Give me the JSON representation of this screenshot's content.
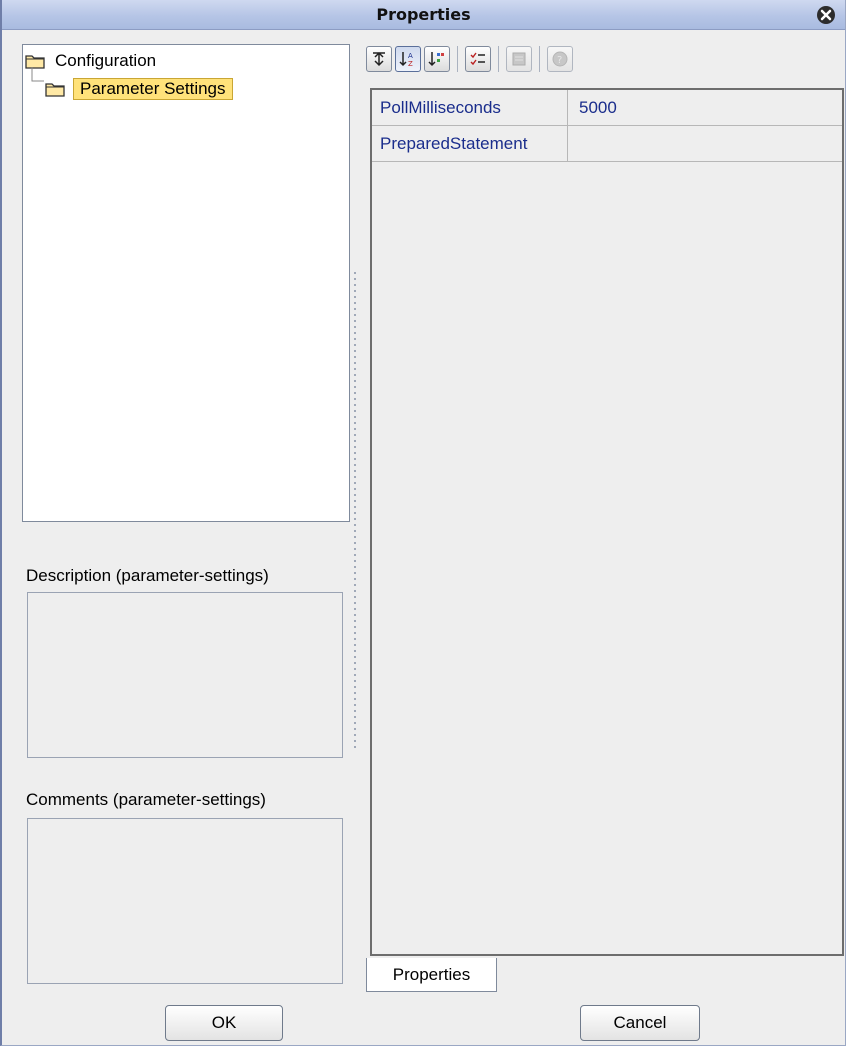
{
  "window": {
    "title": "Properties"
  },
  "tree": {
    "root": {
      "label": "Configuration",
      "icon": "folder-icon"
    },
    "child": {
      "label": "Parameter Settings",
      "icon": "folder-icon",
      "selected": true
    }
  },
  "description": {
    "label": "Description (parameter-settings)",
    "text": ""
  },
  "comments": {
    "label": "Comments (parameter-settings)",
    "text": ""
  },
  "toolbar": {
    "buttons": [
      {
        "icon": "collapse-icon",
        "pressed": false,
        "disabled": false
      },
      {
        "icon": "sort-alphabetical-icon",
        "pressed": true,
        "disabled": false
      },
      {
        "icon": "sort-category-icon",
        "pressed": false,
        "disabled": false
      },
      {
        "icon": "checklist-icon",
        "pressed": false,
        "disabled": false
      },
      {
        "icon": "property-pages-icon",
        "pressed": false,
        "disabled": true
      },
      {
        "icon": "help-icon",
        "pressed": false,
        "disabled": true
      }
    ]
  },
  "properties": {
    "rows": [
      {
        "name": "PollMilliseconds",
        "value": "5000"
      },
      {
        "name": "PreparedStatement",
        "value": ""
      }
    ]
  },
  "tabs": [
    {
      "label": "Properties",
      "active": true
    }
  ],
  "buttons": {
    "ok": "OK",
    "cancel": "Cancel"
  },
  "colors": {
    "title_gradient_top": "#cfd9f0",
    "selection_highlight": "#ffe27a",
    "property_text": "#1a2d8c"
  }
}
